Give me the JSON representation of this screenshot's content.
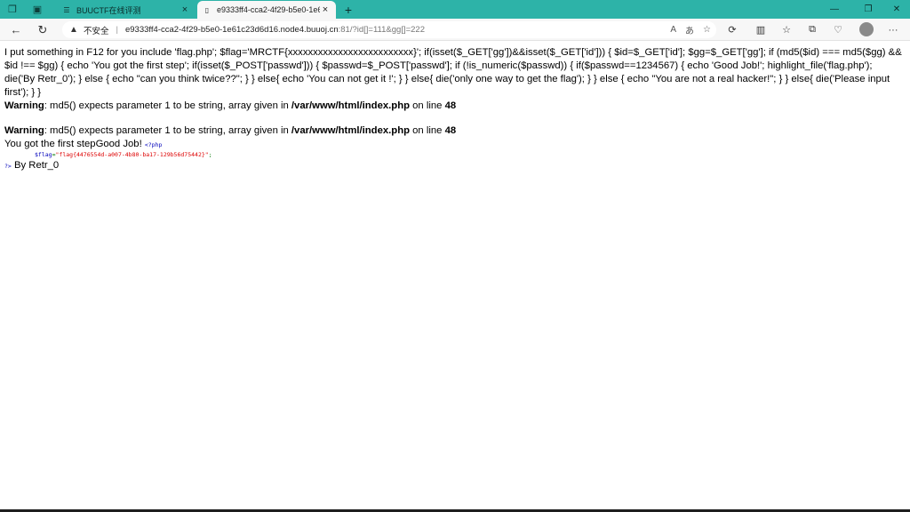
{
  "browser": {
    "tabs": [
      {
        "title": "BUUCTF在线评测",
        "active": false
      },
      {
        "title": "e9333ff4-cca2-4f29-b5e0-1e61c2",
        "active": true
      }
    ],
    "address": {
      "security_label": "不安全",
      "url_host": "e9333ff4-cca2-4f29-b5e0-1e61c23d6d16.node4.buuoj.cn",
      "url_rest": ":81/?id[]=111&gg[]=222"
    }
  },
  "page": {
    "source_text": "I put something in F12 for you include 'flag.php'; $flag='MRCTF{xxxxxxxxxxxxxxxxxxxxxxxxx}'; if(isset($_GET['gg'])&&isset($_GET['id'])) { $id=$_GET['id']; $gg=$_GET['gg']; if (md5($id) === md5($gg) && $id !== $gg) { echo 'You got the first step'; if(isset($_POST['passwd'])) { $passwd=$_POST['passwd']; if (!is_numeric($passwd)) { if($passwd==1234567) { echo 'Good Job!'; highlight_file('flag.php'); die('By Retr_0'); } else { echo \"can you think twice??\"; } } else{ echo 'You can not get it !'; } } else{ die('only one way to get the flag'); } } else { echo \"You are not a real hacker!\"; } } else{ die('Please input first'); } }",
    "warnings": [
      {
        "label": "Warning",
        "message": ": md5() expects parameter 1 to be string, array given in ",
        "file": "/var/www/html/index.php",
        "on_line": " on line ",
        "line": "48"
      },
      {
        "label": "Warning",
        "message": ": md5() expects parameter 1 to be string, array given in ",
        "file": "/var/www/html/index.php",
        "on_line": " on line ",
        "line": "48"
      }
    ],
    "result_text": "You got the first stepGood Job! ",
    "code": {
      "open_tag": "<?php",
      "var": "$flag",
      "assign": "=",
      "value": "\"flag{4476554d-a007-4b80-ba17-129b56d75442}\"",
      "end": ";",
      "close_tag": "?>"
    },
    "by_text": " By Retr_0"
  }
}
